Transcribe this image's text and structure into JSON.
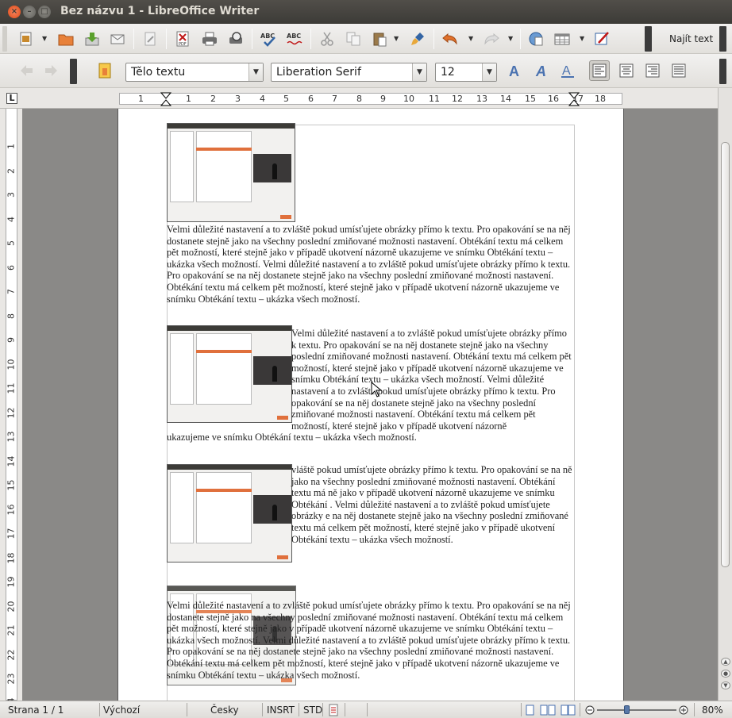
{
  "window": {
    "title": "Bez názvu 1 - LibreOffice Writer",
    "close": "×",
    "minimize": "–",
    "maximize": "□"
  },
  "toolbar2": {
    "paragraph_style": "Tělo textu",
    "font_name": "Liberation Serif",
    "font_size": "12"
  },
  "toolbar1": {
    "find_label": "Najít text"
  },
  "ruler": {
    "corner": "L",
    "marks": [
      "1",
      "1",
      "2",
      "3",
      "4",
      "5",
      "6",
      "7",
      "8",
      "9",
      "10",
      "11",
      "12",
      "13",
      "14",
      "15",
      "16",
      "17",
      "18"
    ],
    "vmarks": [
      "1",
      "2",
      "3",
      "4",
      "5",
      "6",
      "7",
      "8",
      "9",
      "10",
      "11",
      "12",
      "13",
      "14",
      "15",
      "16",
      "17",
      "18",
      "19",
      "20",
      "21",
      "22",
      "23",
      "24"
    ]
  },
  "document": {
    "p1": "Velmi důležité nastavení a to zvláště pokud umísťujete obrázky přímo k textu. Pro opakování se na něj dostanete stejně jako na všechny poslední zmiňované možnosti nastavení. Obtékání textu má celkem pět možností, které stejně jako v případě ukotvení názorně ukazujeme ve snímku Obtékání textu – ukázka všech možností. Velmi důležité nastavení a to zvláště pokud umísťujete obrázky přímo k textu. Pro opakování se na něj dostanete stejně jako na všechny poslední zmiňované možnosti nastavení. Obtékání textu má celkem pět možností, které stejně jako v případě ukotvení názorně ukazujeme ve snímku Obtékání textu – ukázka všech možností.",
    "p2": "Velmi důležité nastavení a to zvláště pokud umísťujete obrázky přímo k textu. Pro opakování se na něj dostanete stejně jako na všechny poslední zmiňované možnosti nastavení. Obtékání textu má celkem pět možností, které stejně jako v případě ukotvení názorně ukazujeme ve snímku Obtékání textu – ukázka všech možností. Velmi důležité nastavení a to zvláště pokud umísťujete obrázky přímo k textu. Pro opakování se na něj dostanete stejně jako na všechny poslední zmiňované možnosti nastavení. Obtékání textu má celkem pět možností, které stejně jako v případě ukotvení názorně",
    "p2_tail": "ukazujeme ve snímku Obtékání textu – ukázka všech možností.",
    "p3": "vláště pokud umísťujete obrázky přímo k textu. Pro opakování se na ně jako na všechny poslední zmiňované možnosti nastavení. Obtékání textu má ně jako v případě ukotvení názorně ukazujeme ve snímku Obtékání . Velmi důležité nastavení a to zvláště pokud umísťujete obrázky e na něj dostanete stejně jako na všechny poslední zmiňované textu má celkem pět možností, které stejně jako v případě ukotvení Obtékání textu – ukázka všech možností.",
    "p4": "Velmi důležité nastavení a to zvláště pokud umísťujete obrázky přímo k textu. Pro opakování se na něj dostanete stejně jako na všechny poslední zmiňované možnosti nastavení. Obtékání textu má celkem pět možností, které stejně jako v případě ukotvení názorně ukazujeme ve snímku Obtékání textu – ukázka všech možností. Velmi důležité nastavení a to zvláště pokud umísťujete obrázky přímo k textu. Pro opakování se na něj dostanete stejně jako na všechny poslední zmiňované možnosti nastavení. Obtékání textu má celkem pět možností, které stejně jako v případě ukotvení názorně ukazujeme ve snímku Obtékání textu – ukázka všech možností."
  },
  "status": {
    "page": "Strana 1 / 1",
    "style": "Výchozí",
    "language": "Česky",
    "insert_mode": "INSRT",
    "selection_mode": "STD",
    "zoom": "80%",
    "zoom_level": 0.8
  },
  "colors": {
    "accent": "#e0703c",
    "title_bg": "#3c3b37",
    "page": "#ffffff",
    "canvas": "#8a8987"
  }
}
